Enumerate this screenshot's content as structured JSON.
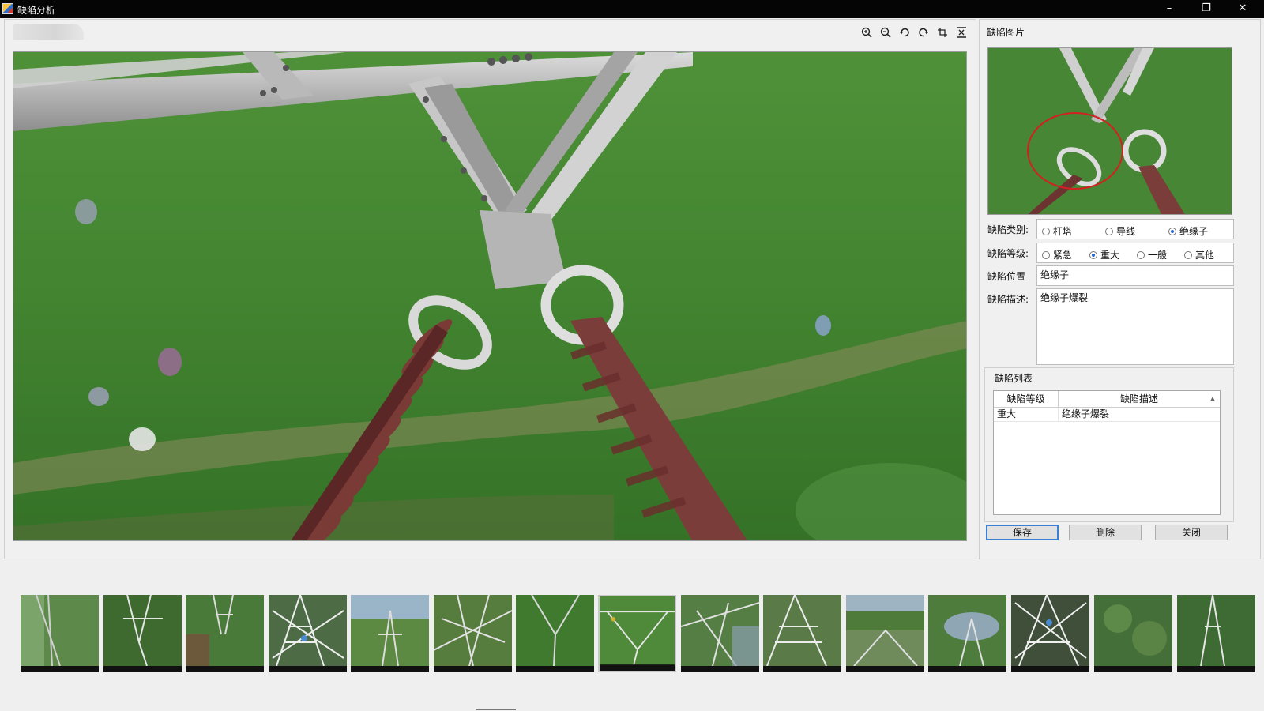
{
  "window": {
    "title": "缺陷分析",
    "controls": [
      "minimize",
      "maximize",
      "close"
    ]
  },
  "toolbar": {
    "tools": [
      {
        "name": "zoom-in-icon",
        "glyph": "⊕"
      },
      {
        "name": "zoom-out-icon",
        "glyph": "⊖"
      },
      {
        "name": "rotate-left-icon",
        "glyph": "↶"
      },
      {
        "name": "rotate-right-icon",
        "glyph": "↷"
      },
      {
        "name": "crop-icon",
        "glyph": "⌗"
      },
      {
        "name": "fit-icon",
        "glyph": "⌧"
      }
    ]
  },
  "side": {
    "preview_title": "缺陷图片",
    "category_label": "缺陷类别:",
    "category_options": [
      "杆塔",
      "导线",
      "绝缘子"
    ],
    "category_selected": "绝缘子",
    "level_label": "缺陷等级:",
    "level_options": [
      "紧急",
      "重大",
      "一般",
      "其他"
    ],
    "level_selected": "重大",
    "position_label": "缺陷位置",
    "position_value": "绝缘子",
    "description_label": "缺陷描述:",
    "description_value": "绝缘子爆裂",
    "list_title": "缺陷列表",
    "table_headers": [
      "缺陷等级",
      "缺陷描述"
    ],
    "table_rows": [
      {
        "level": "重大",
        "description": "绝缘子爆裂"
      }
    ]
  },
  "buttons": {
    "save": "保存",
    "delete": "删除",
    "close": "关闭"
  },
  "filmstrip": {
    "count": 15,
    "selected_index": 7
  },
  "colors": {
    "titlebar": "#050505",
    "accent": "#3b7ed6",
    "defect_circle": "#d32020"
  }
}
